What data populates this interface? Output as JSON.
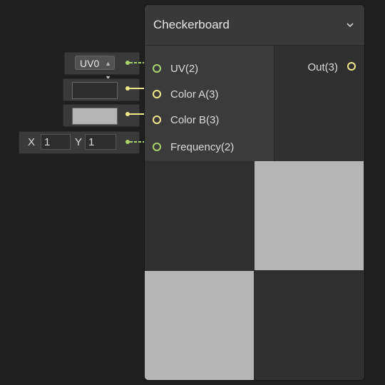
{
  "node": {
    "title": "Checkerboard",
    "menu_icon": "chevron-down-icon",
    "inputs": [
      {
        "label": "UV(2)",
        "color": "#a9d46a"
      },
      {
        "label": "Color A(3)",
        "color": "#f0e98a"
      },
      {
        "label": "Color B(3)",
        "color": "#f0e98a"
      },
      {
        "label": "Frequency(2)",
        "color": "#a9d46a"
      }
    ],
    "output": {
      "label": "Out(3)",
      "color": "#f0e98a"
    },
    "preview": {
      "light_color": "#b5b5b5",
      "dark_color": "#2f2f2f"
    }
  },
  "fields": {
    "uv": {
      "value": "UV0",
      "icon": "updown-arrow-icon"
    },
    "color_a": {
      "swatch": "#2e2e2e"
    },
    "color_b": {
      "swatch": "#b5b5b5"
    },
    "frequency": {
      "x_label": "X",
      "x_value": "1",
      "y_label": "Y",
      "y_value": "1"
    }
  }
}
